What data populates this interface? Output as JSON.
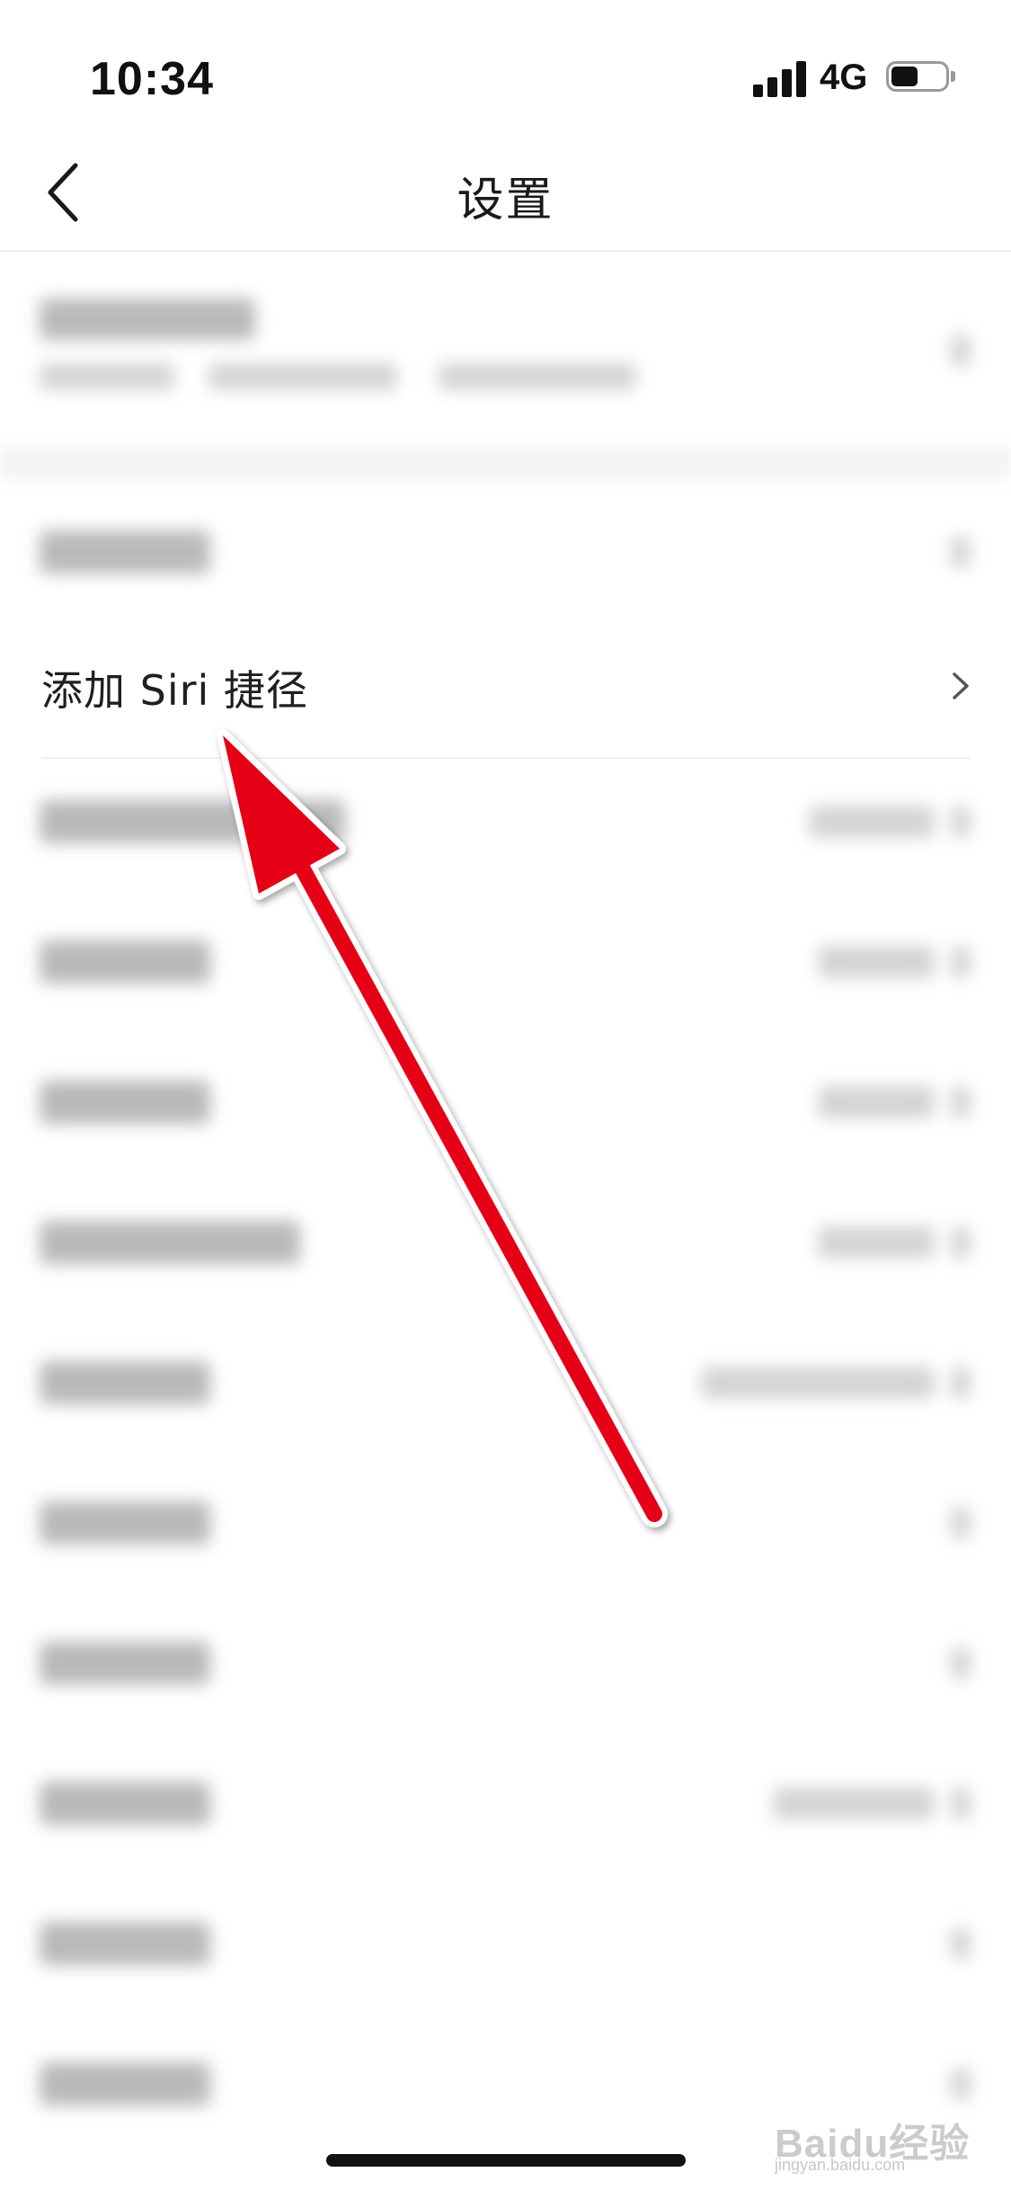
{
  "status_bar": {
    "time": "10:34",
    "network": "4G",
    "battery_level": 0.5
  },
  "nav": {
    "title": "设置"
  },
  "siri_row": {
    "label": "添加 Siri 捷径"
  },
  "watermark": {
    "brand": "Baidu经验",
    "url": "jingyan.baidu.com"
  },
  "colors": {
    "annotation_arrow": "#e60012",
    "text_primary": "#1a1a1a",
    "divider": "#efefef",
    "background": "#ffffff"
  },
  "icons": {
    "back": "chevron-left-icon",
    "row_chevron": "chevron-right-icon",
    "signal": "cellular-signal-icon",
    "battery": "battery-icon"
  }
}
